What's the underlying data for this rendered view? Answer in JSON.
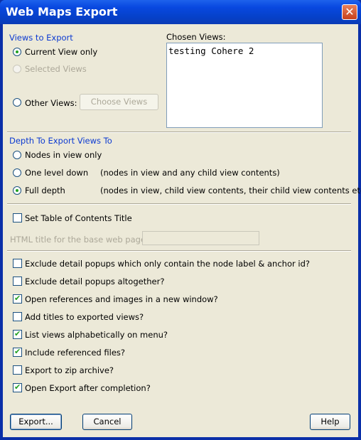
{
  "window": {
    "title": "Web Maps Export",
    "close_glyph": "✕"
  },
  "views": {
    "section_label": "Views to Export",
    "current_view_label": "Current View only",
    "current_view_selected": true,
    "selected_views_label": "Selected Views",
    "selected_views_enabled": false,
    "other_views_label": "Other Views:",
    "choose_views_button": "Choose Views",
    "chosen_views_label": "Chosen Views:",
    "chosen_views_items": [
      "testing Cohere 2"
    ]
  },
  "depth": {
    "section_label": "Depth To Export Views To",
    "options": [
      {
        "label": "Nodes in view only",
        "note": "",
        "selected": false
      },
      {
        "label": "One level down",
        "note": "(nodes in view and any child view contents)",
        "selected": false
      },
      {
        "label": "Full depth",
        "note": "(nodes in view, child view contents, their child view contents etc..)",
        "selected": true
      }
    ]
  },
  "toc": {
    "set_title_label": "Set Table of Contents Title",
    "set_title_checked": false,
    "html_title_label": "HTML title for the base web page:",
    "html_title_value": ""
  },
  "options": [
    {
      "label": "Exclude detail popups which only contain the node label & anchor id?",
      "checked": false
    },
    {
      "label": "Exclude detail popups altogether?",
      "checked": false
    },
    {
      "label": "Open references and images in a new window?",
      "checked": true
    },
    {
      "label": "Add titles to exported views?",
      "checked": false
    },
    {
      "label": "List views alphabetically on menu?",
      "checked": true
    },
    {
      "label": "Include referenced files?",
      "checked": true
    },
    {
      "label": "Export to zip archive?",
      "checked": false
    },
    {
      "label": "Open Export after completion?",
      "checked": true
    }
  ],
  "buttons": {
    "export": "Export...",
    "cancel": "Cancel",
    "help": "Help"
  },
  "icons": {
    "radio": "radio-button",
    "checkbox": "checkbox",
    "tick": "✔"
  },
  "colors": {
    "title_bar": "#0848e0",
    "section_label": "#0c3ad1",
    "dialog_bg": "#ece9d8",
    "check_green": "#21a121"
  }
}
